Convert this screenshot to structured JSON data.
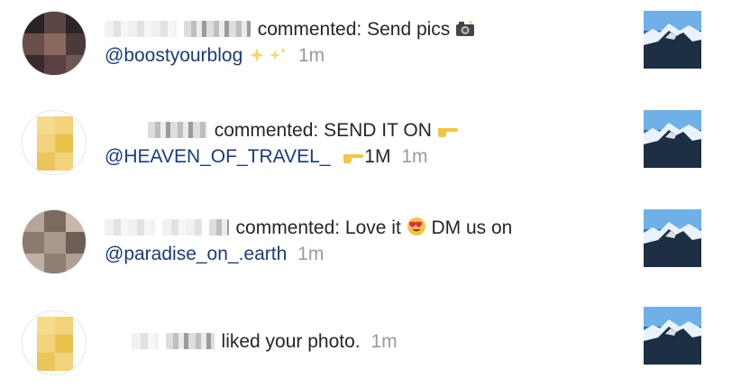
{
  "notifications": [
    {
      "type": "comment",
      "action_text": "commented: Send pics",
      "emoji_name": "camera-emoji",
      "handle": "@boostyourblog",
      "extra_emoji_name": "sparkles-emoji",
      "time": "1m",
      "avatar_colors": [
        "#4a3a3a",
        "#6b4e4a",
        "#3a2a2e",
        "#8a6a5e",
        "#2e2428",
        "#5a4040"
      ]
    },
    {
      "type": "comment",
      "action_text": "commented: SEND IT ON",
      "emoji_name": "pointing-hand-emoji",
      "handle": "@HEAVEN_OF_TRAVEL_",
      "extra_text": "1M",
      "extra_emoji_name": "pointing-hand-emoji",
      "time": "1m",
      "avatar_colors": [
        "#f2d27a",
        "#e8c24a",
        "#f5dc8c",
        "#e9c55a"
      ]
    },
    {
      "type": "comment",
      "action_text": "commented: Love it",
      "emoji_name": "heart-eyes-emoji",
      "action_text_after": "DM us on",
      "handle": "@paradise_on_.earth",
      "time": "1m",
      "avatar_colors": [
        "#9a8a80",
        "#b5a498",
        "#7a6a62",
        "#c8b8ac",
        "#8a7a70",
        "#a8988c"
      ]
    },
    {
      "type": "like",
      "action_text": "liked your photo.",
      "time": "1m",
      "avatar_colors": [
        "#f2d27a",
        "#e8c24a",
        "#f5dc8c",
        "#e9c55a"
      ]
    }
  ],
  "colors": {
    "handle": "#1a3c7a",
    "time": "#9a9a9a",
    "text": "#262626"
  }
}
